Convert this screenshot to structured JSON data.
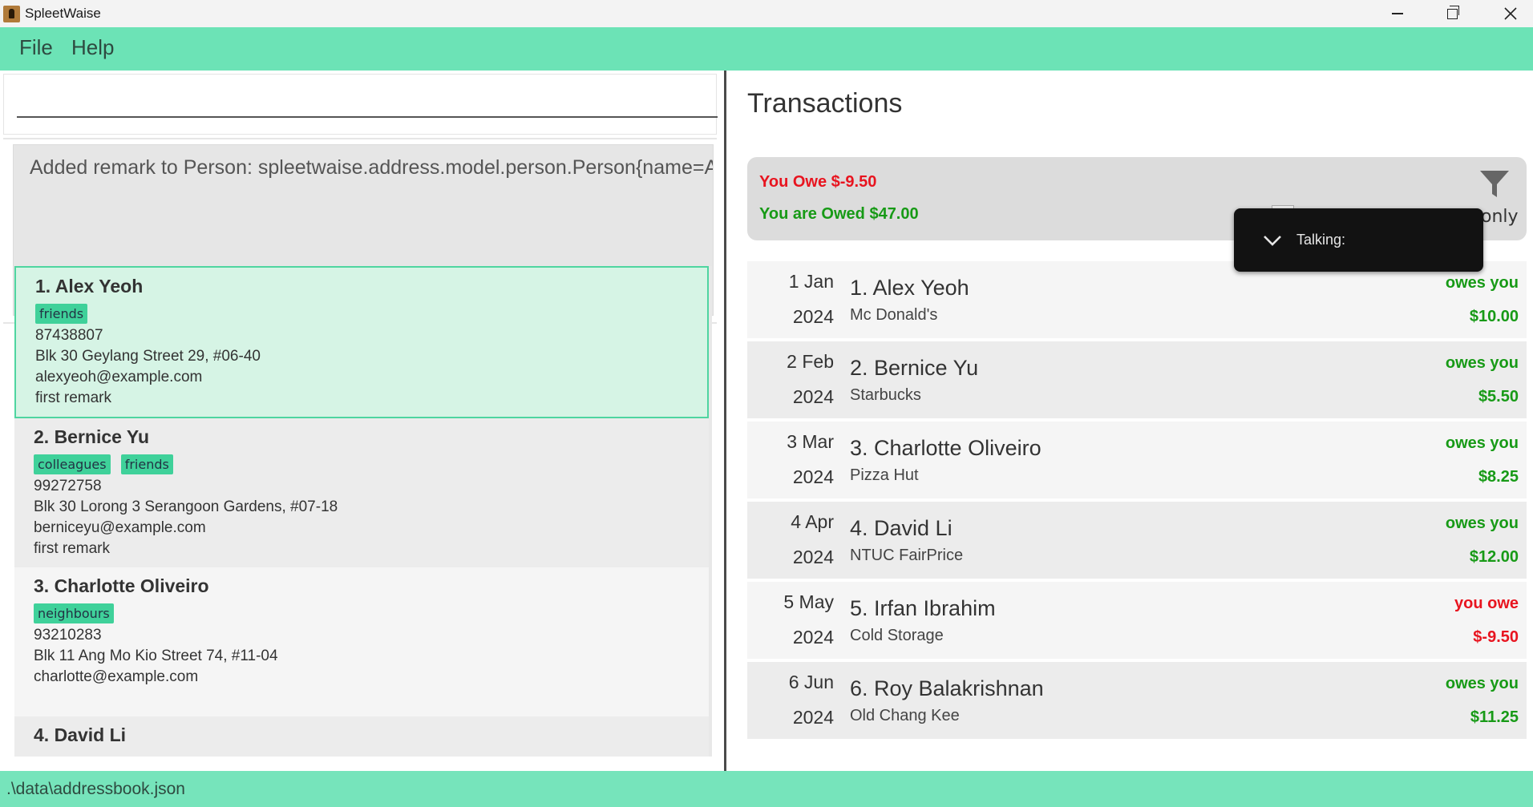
{
  "window": {
    "title": "SpleetWaise"
  },
  "menu": {
    "items": [
      "File",
      "Help"
    ]
  },
  "command": {
    "value": "",
    "placeholder": ""
  },
  "result": {
    "text": "Added remark to Person: spleetwaise.address.model.person.Person{name=Alex Yeoh"
  },
  "persons": [
    {
      "name": "1. Alex Yeoh",
      "tags": [
        "friends"
      ],
      "phone": "87438807",
      "address": "Blk 30 Geylang Street 29, #06-40",
      "email": "alexyeoh@example.com",
      "remark": "first remark"
    },
    {
      "name": "2. Bernice Yu",
      "tags": [
        "colleagues",
        "friends"
      ],
      "phone": "99272758",
      "address": "Blk 30 Lorong 3 Serangoon Gardens, #07-18",
      "email": "berniceyu@example.com",
      "remark": "first remark"
    },
    {
      "name": "3. Charlotte Oliveiro",
      "tags": [
        "neighbours"
      ],
      "phone": "93210283",
      "address": "Blk 11 Ang Mo Kio Street 74, #11-04",
      "email": "charlotte@example.com",
      "remark": ""
    },
    {
      "name": "4. David Li",
      "tags": [],
      "phone": "",
      "address": "",
      "email": "",
      "remark": ""
    }
  ],
  "transactions_panel": {
    "heading": "Transactions",
    "you_owe": "You Owe $-9.50",
    "you_are_owed": "You are Owed $47.00",
    "filter_label_partial": "only",
    "icons": {
      "filter": "filter-icon"
    },
    "colors": {
      "owed": "#179a16",
      "owe": "#e8141f",
      "accent": "#6ce3b6"
    }
  },
  "transactions": [
    {
      "day": "1 Jan",
      "year": "2024",
      "name": "1. Alex Yeoh",
      "description": "Mc Donald's",
      "direction": "owes you",
      "amount": "$10.00",
      "status": "green"
    },
    {
      "day": "2 Feb",
      "year": "2024",
      "name": "2. Bernice Yu",
      "description": "Starbucks",
      "direction": "owes you",
      "amount": "$5.50",
      "status": "green"
    },
    {
      "day": "3 Mar",
      "year": "2024",
      "name": "3. Charlotte Oliveiro",
      "description": "Pizza Hut",
      "direction": "owes you",
      "amount": "$8.25",
      "status": "green"
    },
    {
      "day": "4 Apr",
      "year": "2024",
      "name": "4. David Li",
      "description": "NTUC FairPrice",
      "direction": "owes you",
      "amount": "$12.00",
      "status": "green"
    },
    {
      "day": "5 May",
      "year": "2024",
      "name": "5. Irfan Ibrahim",
      "description": "Cold Storage",
      "direction": "you owe",
      "amount": "$-9.50",
      "status": "red"
    },
    {
      "day": "6 Jun",
      "year": "2024",
      "name": "6. Roy Balakrishnan",
      "description": "Old Chang Kee",
      "direction": "owes you",
      "amount": "$11.25",
      "status": "green"
    }
  ],
  "tooltip": {
    "text": "Talking:"
  },
  "status": {
    "path": ".\\data\\addressbook.json"
  }
}
